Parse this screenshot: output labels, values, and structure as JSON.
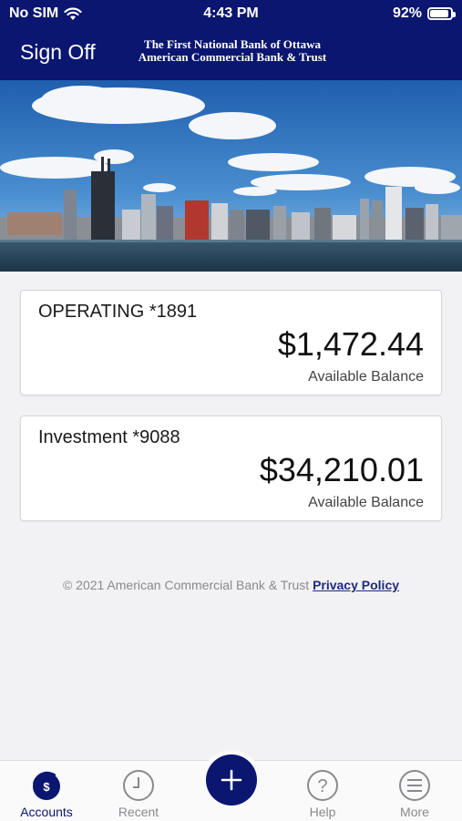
{
  "status_bar": {
    "carrier": "No SIM",
    "time": "4:43 PM",
    "battery_percent_label": "92%",
    "battery_level": 0.92,
    "icons": [
      "wifi-icon",
      "battery-icon"
    ]
  },
  "header": {
    "sign_off": "Sign Off",
    "bank_line1": "The First National Bank of Ottawa",
    "bank_line2": "American Commercial Bank & Trust",
    "background_color": "#0a1670"
  },
  "accounts": [
    {
      "name": "OPERATING *1891",
      "balance": "$1,472.44",
      "balance_label": "Available Balance"
    },
    {
      "name": "Investment *9088",
      "balance": "$34,210.01",
      "balance_label": "Available Balance"
    }
  ],
  "footer": {
    "copyright": "© 2021 American Commercial Bank & Trust",
    "privacy_link": "Privacy Policy"
  },
  "tabbar": {
    "tabs": [
      {
        "label": "Accounts",
        "icon": "dollar-circle-icon",
        "active": true
      },
      {
        "label": "Recent",
        "icon": "clock-icon",
        "active": false
      },
      {
        "label": "Help",
        "icon": "question-circle-icon",
        "active": false
      },
      {
        "label": "More",
        "icon": "hamburger-menu-icon",
        "active": false
      }
    ],
    "center_button_icon": "plus-icon"
  }
}
